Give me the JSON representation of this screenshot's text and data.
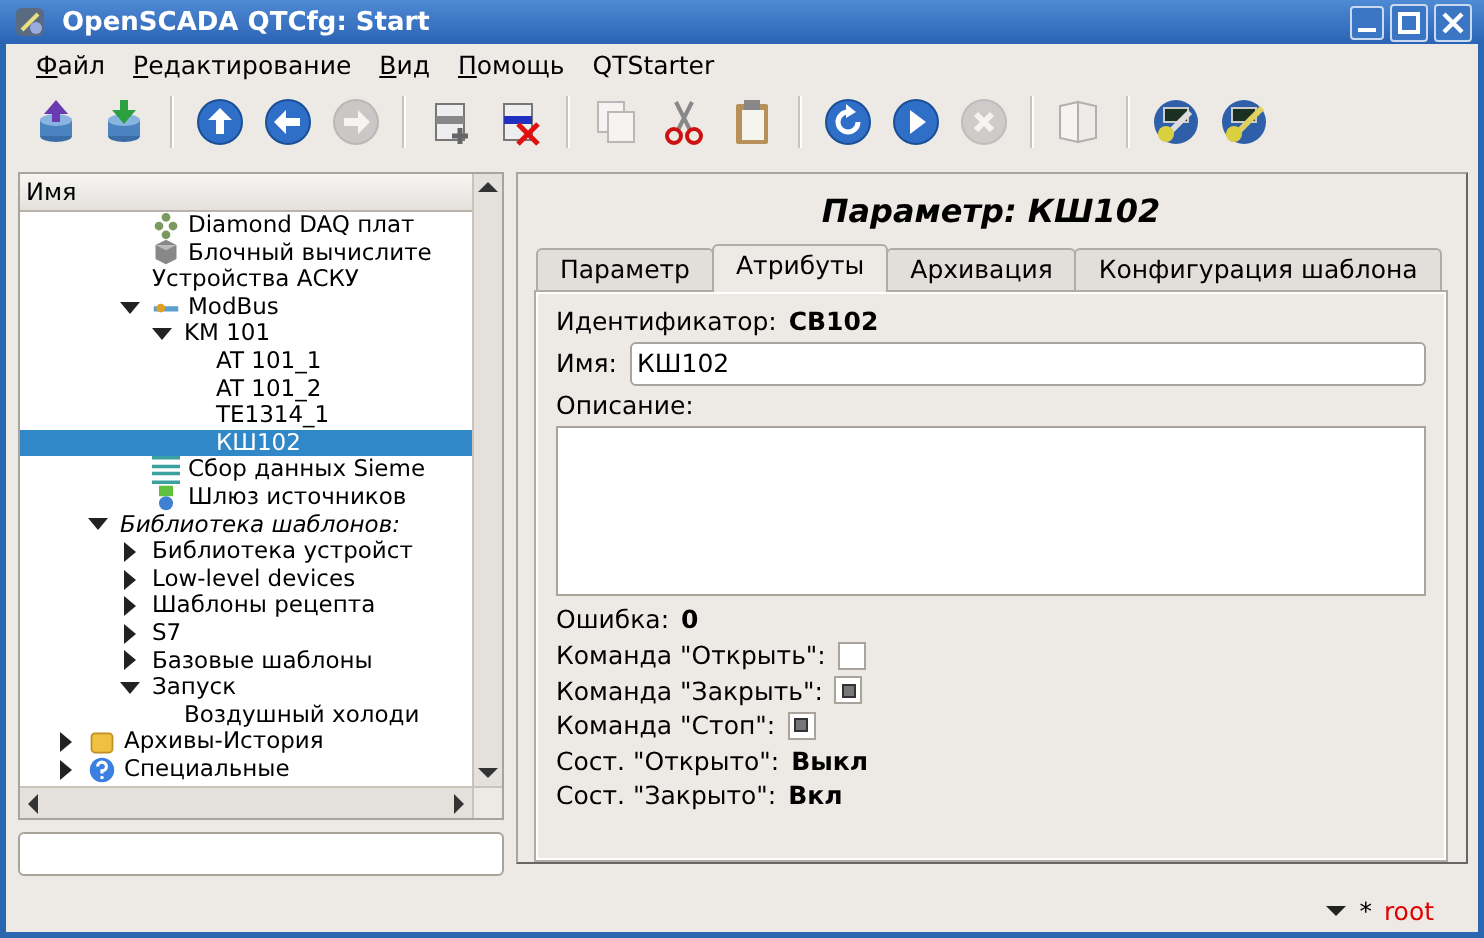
{
  "window": {
    "title": "OpenSCADA QTCfg: Start"
  },
  "menu": [
    {
      "label": "Файл",
      "mnemonic": true
    },
    {
      "label": "Редактирование",
      "mnemonic": true
    },
    {
      "label": "Вид",
      "mnemonic": true
    },
    {
      "label": "Помощь",
      "mnemonic": true
    },
    {
      "label": "QTStarter",
      "mnemonic": false
    }
  ],
  "toolbar": [
    {
      "kind": "db-load",
      "disabled": false
    },
    {
      "kind": "db-save",
      "disabled": false
    },
    {
      "kind": "separator"
    },
    {
      "kind": "up",
      "disabled": false
    },
    {
      "kind": "back",
      "disabled": false
    },
    {
      "kind": "forward",
      "disabled": true
    },
    {
      "kind": "separator"
    },
    {
      "kind": "add",
      "disabled": false
    },
    {
      "kind": "delete",
      "disabled": false
    },
    {
      "kind": "separator"
    },
    {
      "kind": "copy",
      "disabled": true
    },
    {
      "kind": "cut",
      "disabled": false
    },
    {
      "kind": "paste",
      "disabled": false
    },
    {
      "kind": "separator"
    },
    {
      "kind": "refresh",
      "disabled": false
    },
    {
      "kind": "start",
      "disabled": false
    },
    {
      "kind": "stop",
      "disabled": true
    },
    {
      "kind": "separator"
    },
    {
      "kind": "book",
      "disabled": true
    },
    {
      "kind": "separator"
    },
    {
      "kind": "tool-a",
      "disabled": false
    },
    {
      "kind": "tool-b",
      "disabled": false
    }
  ],
  "tree": {
    "header": "Имя",
    "items": [
      {
        "children": [
          {
            "children": [
              {
                "label": "Diamond DAQ плат",
                "kind": "board",
                "selected": false
              },
              {
                "label": "Блочный вычислите",
                "kind": "cube",
                "selected": false
              },
              {
                "label": "Устройства АСКУ",
                "selected": false
              },
              {
                "label": "ModBus",
                "kind": "modbus",
                "expanded": true,
                "selected": false,
                "children": [
                  {
                    "label": "KM 101",
                    "expanded": true,
                    "selected": false,
                    "children": [
                      {
                        "label": "AT 101_1",
                        "selected": false
                      },
                      {
                        "label": "AT 101_2",
                        "selected": false
                      },
                      {
                        "label": "TE1314_1",
                        "selected": false
                      },
                      {
                        "label": "КШ102",
                        "selected": true
                      }
                    ]
                  }
                ]
              },
              {
                "label": "Сбор данных Sieme",
                "kind": "siemens",
                "selected": false
              },
              {
                "label": "Шлюз источников",
                "kind": "gateway",
                "selected": false
              }
            ]
          },
          {
            "label": "Библиотека шаблонов:",
            "italic": true,
            "expanded": true,
            "selected": false,
            "children": [
              {
                "label": "Библиотека устройст",
                "expanded": false,
                "selected": false
              },
              {
                "label": "Low-level devices",
                "expanded": false,
                "selected": false
              },
              {
                "label": "Шаблоны рецепта",
                "expanded": false,
                "selected": false
              },
              {
                "label": "S7",
                "expanded": false,
                "selected": false
              },
              {
                "label": "Базовые шаблоны",
                "expanded": false,
                "selected": false
              },
              {
                "label": "Запуск",
                "expanded": true,
                "selected": false,
                "children": [
                  {
                    "label": "Воздушный холоди",
                    "selected": false
                  }
                ]
              }
            ]
          }
        ]
      },
      {
        "label": "Архивы-История",
        "kind": "archive",
        "expanded": false,
        "selected": false
      },
      {
        "label": "Специальные",
        "kind": "help",
        "expanded": false,
        "selected": false
      }
    ]
  },
  "panel": {
    "title": "Параметр: КШ102",
    "tabs": [
      {
        "label": "Параметр",
        "selected": false
      },
      {
        "label": "Атрибуты",
        "selected": true
      },
      {
        "label": "Архивация",
        "selected": false
      },
      {
        "label": "Конфигурация шаблона",
        "selected": false
      }
    ],
    "fields": [
      {
        "kind": "text",
        "label": "Идентификатор:",
        "value": "CB102"
      },
      {
        "kind": "input",
        "label": "Имя:",
        "value": "КШ102"
      },
      {
        "kind": "textarea",
        "label": "Описание:"
      },
      {
        "kind": "text",
        "label": "Ошибка:",
        "value": "0"
      },
      {
        "kind": "checkbox",
        "label": "Команда \"Открыть\":",
        "checked": false
      },
      {
        "kind": "checkbox",
        "label": "Команда \"Закрыть\":",
        "checked": true
      },
      {
        "kind": "checkbox",
        "label": "Команда \"Стоп\":",
        "checked": true
      },
      {
        "kind": "text",
        "label": "Сост. \"Открыто\":",
        "value": "Выкл"
      },
      {
        "kind": "text",
        "label": "Сост. \"Закрыто\":",
        "value": "Вкл"
      }
    ]
  },
  "status_bar": {
    "mark": "*",
    "user": "root"
  }
}
